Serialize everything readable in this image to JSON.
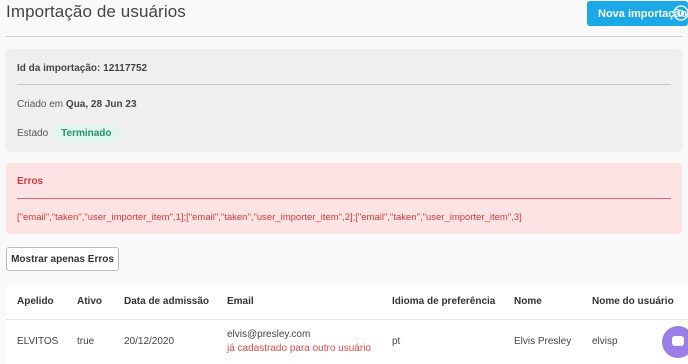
{
  "header": {
    "title": "Importação de usuários",
    "new_import_label": "Nova importação",
    "settings_icon": "gear-icon"
  },
  "info": {
    "import_id_label": "Id da importação:",
    "import_id_value": "12117752",
    "created_label": "Criado em",
    "created_value": "Qua, 28 Jun 23",
    "state_label": "Estado",
    "state_value": "Terminado"
  },
  "errors": {
    "title": "Erros",
    "text": "[\"email\",\"taken\",\"user_importer_item\",1];[\"email\",\"taken\",\"user_importer_item\",2];[\"email\",\"taken\",\"user_importer_item\",3]"
  },
  "filter": {
    "show_errors_label": "Mostrar apenas Erros"
  },
  "table": {
    "columns": [
      "Apelido",
      "Ativo",
      "Data de admissão",
      "Email",
      "Idioma de preferência",
      "Nome",
      "Nome do usuário"
    ],
    "rows": [
      {
        "apelido": "ELVITOS",
        "ativo": "true",
        "data_admissao": "20/12/2020",
        "email": "elvis@presley.com",
        "email_error": "já cadastrado para outro usuário",
        "idioma": "pt",
        "nome": "Elvis Presley",
        "nome_usuario": "elvisp"
      }
    ]
  },
  "colors": {
    "accent": "#1aa8e6",
    "success_bg": "#dff5ee",
    "success_text": "#2a8f6a",
    "error_bg": "#fde3e3",
    "error_text": "#d63a3a",
    "chat": "#9b7fe8"
  }
}
